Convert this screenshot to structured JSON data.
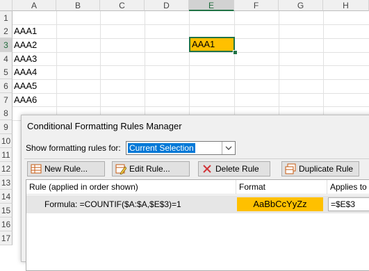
{
  "sheet": {
    "columns": [
      "A",
      "B",
      "C",
      "D",
      "E",
      "F",
      "G",
      "H"
    ],
    "selected_column": "E",
    "rows": [
      "1",
      "2",
      "3",
      "4",
      "5",
      "6",
      "7",
      "8",
      "9",
      "10",
      "11",
      "12",
      "13",
      "14",
      "15",
      "16",
      "17"
    ],
    "selected_row": "3",
    "cells": [
      "AAA1",
      "AAA2",
      "AAA3",
      "AAA4",
      "AAA5",
      "AAA6"
    ],
    "active_cell_value": "AAA1",
    "highlight_color": "#ffc000",
    "selection_color": "#217346"
  },
  "dialog": {
    "title": "Conditional Formatting Rules Manager",
    "show_label": "Show formatting rules for:",
    "scope_value": "Current Selection",
    "buttons": {
      "new_rule": "New Rule...",
      "edit_rule": "Edit Rule...",
      "delete_rule": "Delete Rule",
      "duplicate_rule": "Duplicate Rule"
    },
    "list": {
      "headers": {
        "rule": "Rule (applied in order shown)",
        "format": "Format",
        "applies_to": "Applies to"
      },
      "rules": [
        {
          "rule": "Formula: =COUNTIF($A:$A,$E$3)=1",
          "format_preview": "AaBbCcYyZz",
          "applies_to": "=$E$3"
        }
      ]
    }
  }
}
